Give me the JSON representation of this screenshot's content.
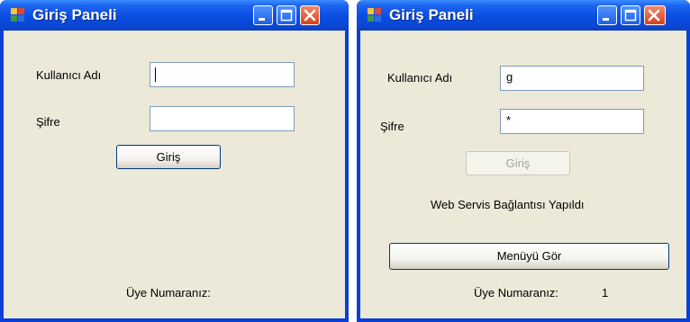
{
  "windows": [
    {
      "title": "Giriş Paneli",
      "username_label": "Kullanıcı Adı",
      "username_value": "",
      "password_label": "Şifre",
      "password_value": "",
      "login_button": "Giriş",
      "member_label": "Üye Numaranız:",
      "member_value": ""
    },
    {
      "title": "Giriş Paneli",
      "username_label": "Kullanıcı Adı",
      "username_value": "g",
      "password_label": "Şifre",
      "password_value": "*",
      "login_button": "Giriş",
      "status_text": "Web Servis Bağlantısı Yapıldı",
      "menu_button": "Menüyü Gör",
      "member_label": "Üye Numaranız:",
      "member_value": "1"
    }
  ],
  "icons": {
    "app": "form-icon",
    "minimize": "minimize-icon",
    "maximize": "maximize-icon",
    "close": "close-icon"
  },
  "colors": {
    "titlebar": "#0a4de0",
    "client_background": "#ece9d8",
    "close_button": "#d5421d"
  }
}
